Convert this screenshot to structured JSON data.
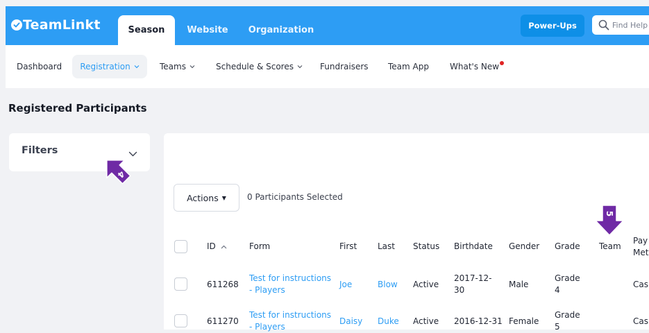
{
  "app": {
    "brand": "TeamLinkt",
    "tabs": [
      {
        "label": "Season",
        "active": true
      },
      {
        "label": "Website",
        "active": false
      },
      {
        "label": "Organization",
        "active": false
      }
    ],
    "powerups_label": "Power-Ups",
    "search_placeholder": "Find Help"
  },
  "subnav": [
    {
      "label": "Dashboard",
      "dropdown": false
    },
    {
      "label": "Registration",
      "dropdown": true,
      "active": true
    },
    {
      "label": "Teams",
      "dropdown": true
    },
    {
      "label": "Schedule & Scores",
      "dropdown": true
    },
    {
      "label": "Fundraisers",
      "dropdown": false
    },
    {
      "label": "Team App",
      "dropdown": false
    },
    {
      "label": "What's New",
      "dropdown": false,
      "notification": true
    }
  ],
  "page_title": "Registered Participants",
  "filters": {
    "label": "Filters"
  },
  "annotations": {
    "step_a": "4",
    "step_b": "5"
  },
  "toolbar": {
    "actions_label": "Actions",
    "selected_text": "0 Participants Selected"
  },
  "table": {
    "headers": {
      "id": "ID",
      "form": "Form",
      "first": "First",
      "last": "Last",
      "status": "Status",
      "birthdate_line1": "Birthdate",
      "gender": "Gender",
      "grade": "Grade",
      "team": "Team",
      "payment_line1": "Pay",
      "payment_line2": "Met"
    },
    "rows": [
      {
        "id": "611268",
        "form_line1": "Test for instructions",
        "form_line2": "- Players",
        "first": "Joe",
        "last": "Blow",
        "status": "Active",
        "birthdate_line1": "2017-12-",
        "birthdate_line2": "30",
        "gender": "Male",
        "grade_line1": "Grade",
        "grade_line2": "4",
        "team": "",
        "payment": "Cas"
      },
      {
        "id": "611270",
        "form_line1": "Test for instructions",
        "form_line2": "- Players",
        "first": "Daisy",
        "last": "Duke",
        "status": "Active",
        "birthdate_line1": "2016-12-31",
        "birthdate_line2": "",
        "gender": "Female",
        "grade_line1": "Grade",
        "grade_line2": "5",
        "team": "",
        "payment": "Cas"
      }
    ]
  },
  "colors": {
    "brand": "#2d9df4",
    "annotation": "#6f2aa5",
    "notification": "#e02424"
  }
}
